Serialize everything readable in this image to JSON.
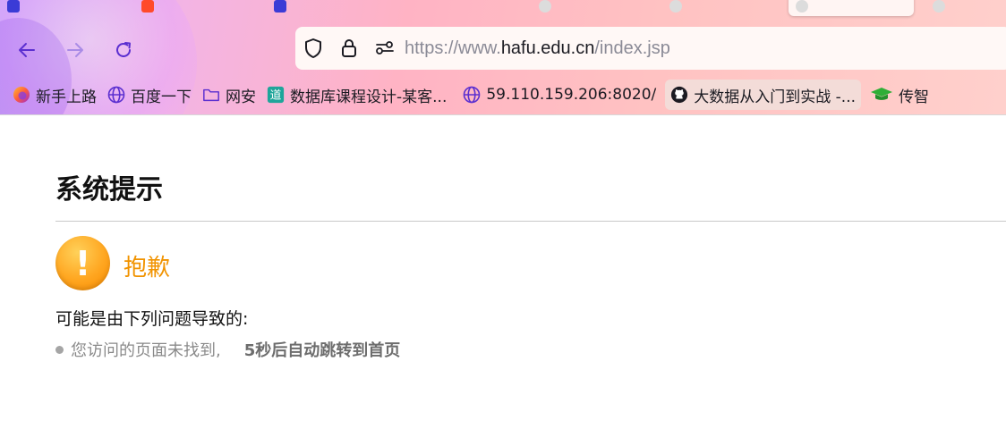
{
  "browser": {
    "tabs": [
      {
        "label": "",
        "favicon": "blue-square"
      },
      {
        "label": "",
        "favicon": "red-square"
      },
      {
        "label": "",
        "favicon": "blue-square"
      },
      {
        "label": "",
        "favicon": "none"
      },
      {
        "label": "",
        "favicon": "globe"
      },
      {
        "label": "",
        "favicon": "globe"
      },
      {
        "label": "",
        "favicon": "globe",
        "active": true
      },
      {
        "label": "",
        "favicon": "globe"
      }
    ],
    "url": {
      "scheme": "https://www.",
      "host": "hafu.edu.cn",
      "path": "/index.jsp"
    },
    "bookmarks": [
      {
        "label": "新手上路",
        "icon": "firefox-icon"
      },
      {
        "label": "百度一下",
        "icon": "globe-icon"
      },
      {
        "label": "网安",
        "icon": "folder-icon"
      },
      {
        "label": "数据库课程设计-某客...",
        "icon": "dao-icon"
      },
      {
        "label": "59.110.159.206:8020/",
        "icon": "globe-icon"
      },
      {
        "label": "大数据从入门到实战 -...",
        "icon": "github-icon"
      },
      {
        "label": "传智",
        "icon": "grad-cap-icon"
      }
    ],
    "accent": "#5b2fd0"
  },
  "page": {
    "title": "系统提示",
    "sorry": "抱歉",
    "reason_title": "可能是由下列问题导致的:",
    "reason_text": "您访问的页面未找到,",
    "redirect_text": "5秒后自动跳转到首页",
    "colors": {
      "sorry": "#f19300",
      "warn_icon": "#ffa620"
    }
  }
}
